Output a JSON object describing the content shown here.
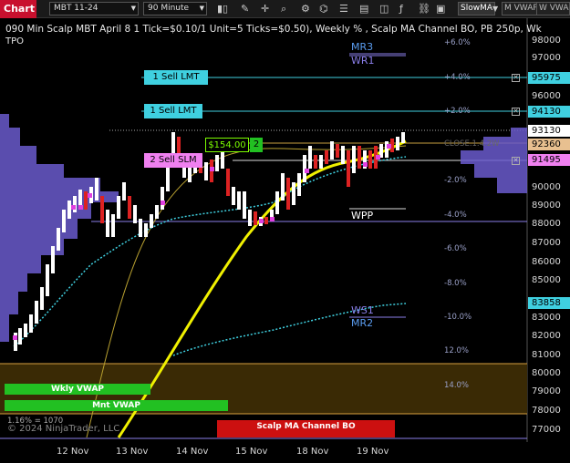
{
  "toolbar": {
    "tab": "Chart",
    "instrument": "MBT 11-24",
    "timeframe": "90 Minute",
    "btn_slowma": "SlowMA",
    "btn_mvwap": "M VWAP",
    "btn_wvwap": "W VWAP"
  },
  "title": "090 Min Scalp MBT April 8 1 Tick=$0.10/1 Unit=5 Ticks=$0.50), Weekly % , Scalp MA Channel BO, PB 250p, Wk",
  "tpo": "TPO",
  "levels": {
    "mr3": "MR3",
    "wr1": "WR1",
    "wpp": "WPP",
    "ws1": "WS1",
    "mr2": "MR2",
    "close": "CLOSE.1.4.2W"
  },
  "orders": {
    "sell1": "1 Sell LMT",
    "sell2": "1 Sell LMT",
    "sell3": "2 Sell SLM",
    "price_label": "$154.00",
    "qty": "2"
  },
  "pcts": [
    "+6.0%",
    "+4.0%",
    "+2.0%",
    "-2.0%",
    "-4.0%",
    "-6.0%",
    "-8.0%",
    "-10.0%",
    "12.0%",
    "14.0%",
    "1.16% = 1070"
  ],
  "yaxis": [
    "98000",
    "97000",
    "96000",
    "94000",
    "93000",
    "92000",
    "91000",
    "90000",
    "89000",
    "88000",
    "87000",
    "86000",
    "85000",
    "84000",
    "83000",
    "82000",
    "81000",
    "80000",
    "79000",
    "78000",
    "77000"
  ],
  "tags": {
    "t1": "95975",
    "t2": "94130",
    "t3": "93130",
    "t4": "92360",
    "t5": "91495",
    "t6": "83858"
  },
  "xaxis": [
    "12 Nov",
    "13 Nov",
    "14 Nov",
    "15 Nov",
    "18 Nov",
    "19 Nov"
  ],
  "bars": {
    "wkly": "Wkly VWAP",
    "mnt": "Mnt VWAP",
    "channel": "Scalp MA Channel BO"
  },
  "copyright": "© 2024 NinjaTrader, LLC",
  "colors": {
    "accent": "#c8102e",
    "cyan": "#3fd0e0",
    "yellow": "#e6e600",
    "violet": "#8a7ee8",
    "green": "#22c022"
  }
}
